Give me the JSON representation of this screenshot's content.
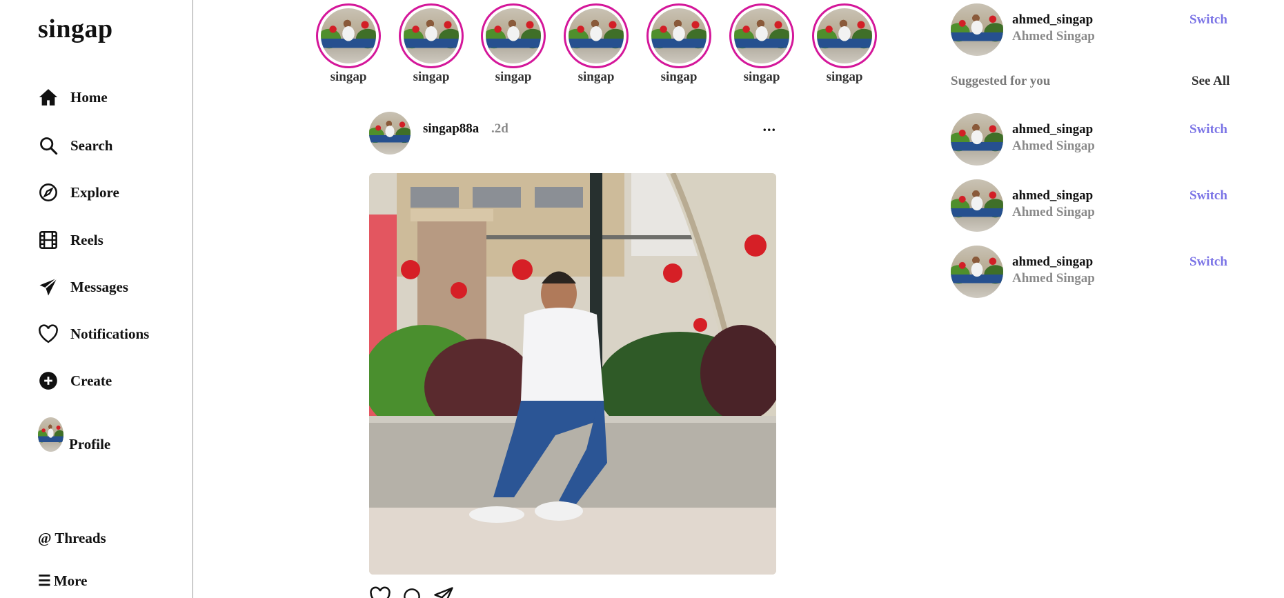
{
  "app": {
    "logo": "singap"
  },
  "sidebar": {
    "items": [
      {
        "label": "Home",
        "icon": "home-icon"
      },
      {
        "label": "Search",
        "icon": "search-icon"
      },
      {
        "label": "Explore",
        "icon": "compass-icon"
      },
      {
        "label": "Reels",
        "icon": "film-icon"
      },
      {
        "label": "Messages",
        "icon": "send-icon"
      },
      {
        "label": "Notifications",
        "icon": "heart-icon"
      },
      {
        "label": "Create",
        "icon": "plus-circle-icon"
      },
      {
        "label": "Profile",
        "icon": "avatar"
      }
    ],
    "threads": "@ Threads",
    "more_icon": "☰",
    "more_label": "More"
  },
  "stories": [
    {
      "label": "singap"
    },
    {
      "label": "singap"
    },
    {
      "label": "singap"
    },
    {
      "label": "singap"
    },
    {
      "label": "singap"
    },
    {
      "label": "singap"
    },
    {
      "label": "singap"
    }
  ],
  "post": {
    "username": "singap88a",
    "time": ".2d",
    "more": "...",
    "actions": [
      "heart-icon",
      "comment-icon",
      "send-icon"
    ]
  },
  "current_account": {
    "username": "ahmed_singap",
    "name": "Ahmed Singap",
    "action": "Switch"
  },
  "suggestions": {
    "title": "Suggested for you",
    "see_all": "See All",
    "items": [
      {
        "username": "ahmed_singap",
        "name": "Ahmed Singap",
        "action": "Switch"
      },
      {
        "username": "ahmed_singap",
        "name": "Ahmed Singap",
        "action": "Switch"
      },
      {
        "username": "ahmed_singap",
        "name": "Ahmed Singap",
        "action": "Switch"
      }
    ]
  },
  "colors": {
    "story_ring": "#d4179a",
    "switch_link": "#7b74e6",
    "muted_text": "#8a8a8a",
    "divider": "#9a9a9a"
  }
}
